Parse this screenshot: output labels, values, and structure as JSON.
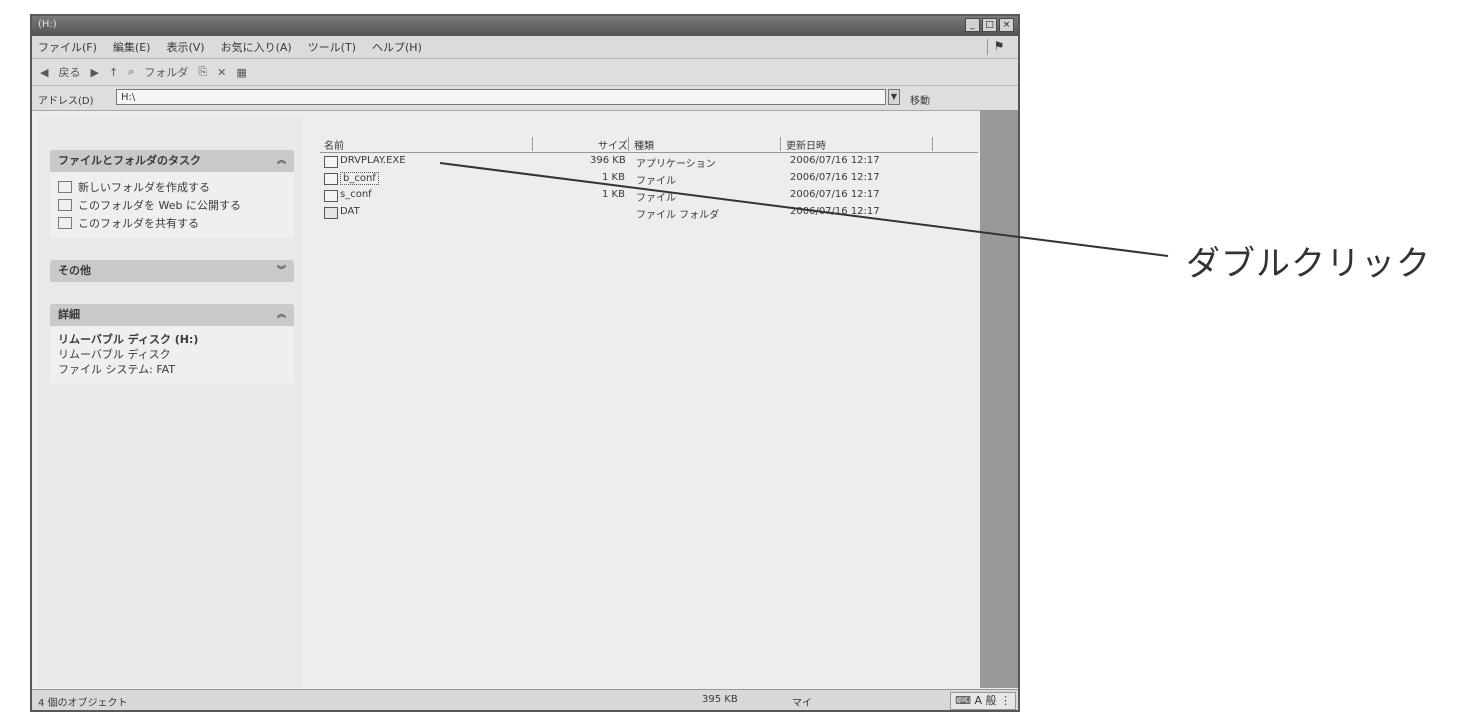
{
  "window": {
    "title": "(H:)",
    "buttons": [
      "_",
      "□",
      "×"
    ]
  },
  "menu": {
    "items": [
      "ファイル(F)",
      "編集(E)",
      "表示(V)",
      "お気に入り(A)",
      "ツール(T)",
      "ヘルプ(H)"
    ]
  },
  "toolbar": {
    "back_label": "戻る",
    "folders_label": "フォルダ",
    "icons": [
      "back-icon",
      "forward-icon",
      "up-icon",
      "search-icon",
      "folders-icon",
      "move-icon",
      "delete-icon",
      "views-icon"
    ]
  },
  "address": {
    "label": "アドレス(D)",
    "value": "H:\\",
    "go_label": "移動"
  },
  "taskpane": {
    "file_tasks": {
      "title": "ファイルとフォルダのタスク",
      "items": [
        "新しいフォルダを作成する",
        "このフォルダを Web に公開する",
        "このフォルダを共有する"
      ]
    },
    "other_places": {
      "title": "その他"
    },
    "details": {
      "title": "詳細",
      "lines": [
        "リムーバブル ディスク (H:)",
        "リムーバブル ディスク",
        "ファイル システム: FAT"
      ]
    }
  },
  "file_list": {
    "columns": [
      "名前",
      "サイズ",
      "種類",
      "更新日時"
    ],
    "rows": [
      {
        "name": "DRVPLAY.EXE",
        "size": "396 KB",
        "type": "アプリケーション",
        "modified": "2006/07/16 12:17"
      },
      {
        "name": "b_conf",
        "size": "1 KB",
        "type": "ファイル",
        "modified": "2006/07/16 12:17"
      },
      {
        "name": "s_conf",
        "size": "1 KB",
        "type": "ファイル",
        "modified": "2006/07/16 12:17"
      },
      {
        "name": "DAT",
        "size": "",
        "type": "ファイル フォルダ",
        "modified": "2006/07/16 12:17"
      }
    ]
  },
  "statusbar": {
    "objects": "4 個のオブジェクト",
    "size": "395 KB",
    "location": "マイ"
  },
  "annotation": {
    "text": "ダブルクリック"
  }
}
